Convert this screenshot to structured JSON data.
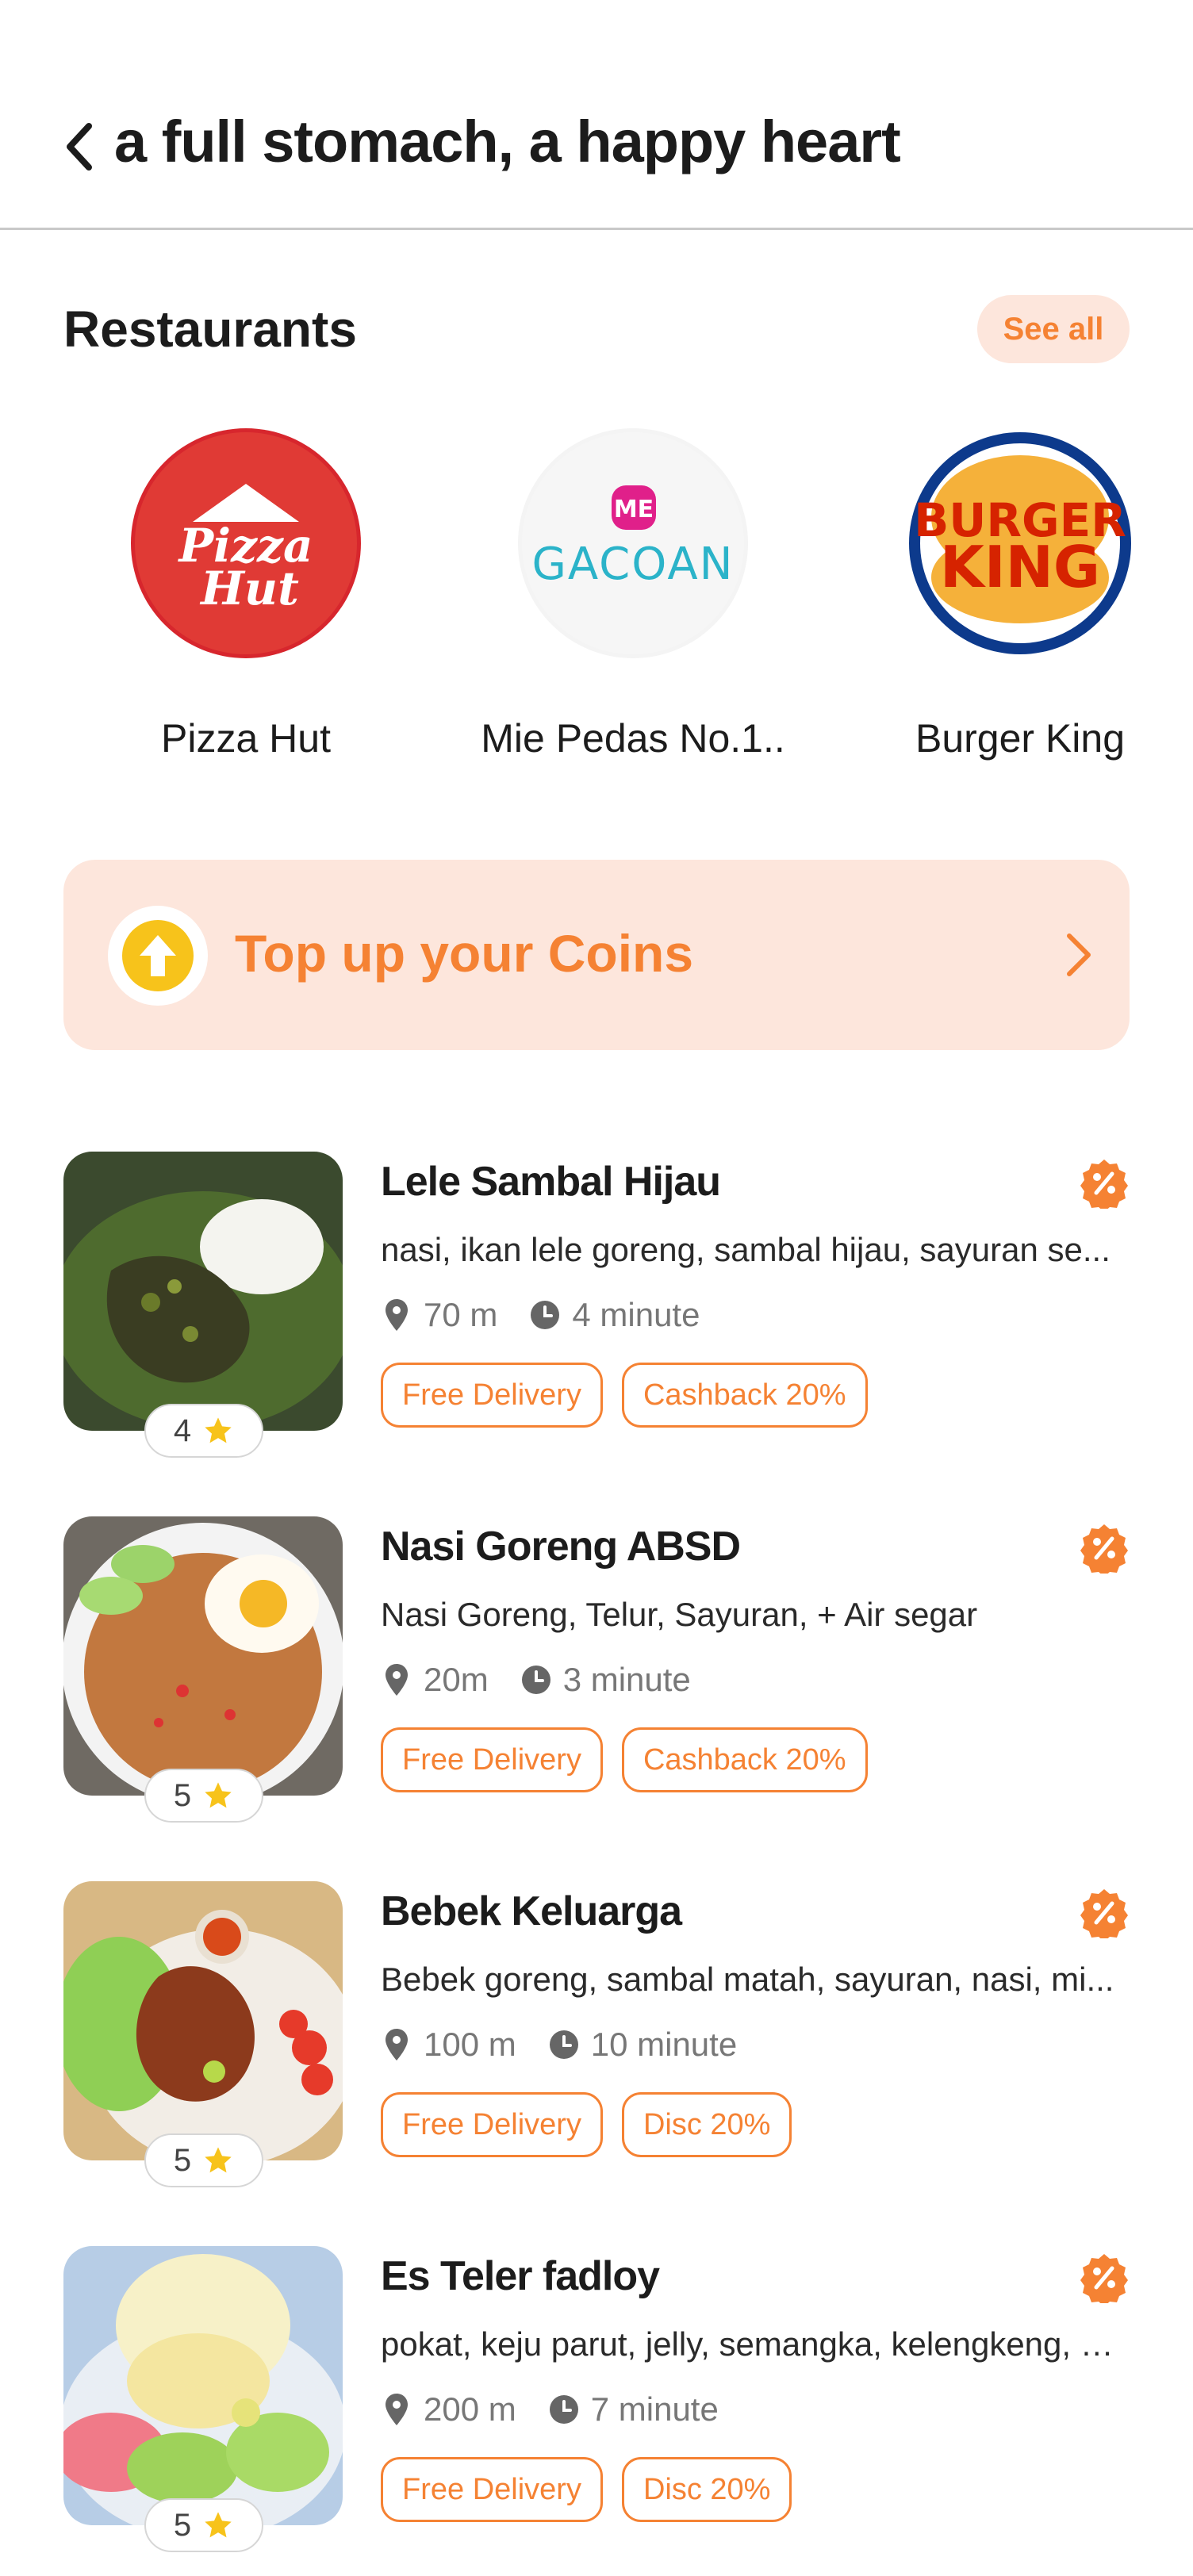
{
  "header": {
    "title": "a full stomach, a happy heart",
    "back_icon": "chevron-left-icon"
  },
  "restaurants_section": {
    "title": "Restaurants",
    "see_all": "See all",
    "items": [
      {
        "name": "Pizza Hut",
        "logo": "pizza-hut-logo"
      },
      {
        "name": "Mie Pedas No.1..",
        "logo": "mie-gacoan-logo"
      },
      {
        "name": "Burger King",
        "logo": "burger-king-logo"
      }
    ]
  },
  "topup": {
    "label": "Top up your Coins",
    "icon": "arrow-up-coin-icon",
    "chevron": "chevron-right-icon"
  },
  "foods": [
    {
      "title": "Lele Sambal Hijau",
      "desc": "nasi, ikan lele goreng, sambal hijau, sayuran se...",
      "distance": "70 m",
      "time": "4 minute",
      "rating": "4",
      "tags": [
        "Free Delivery",
        "Cashback 20%"
      ]
    },
    {
      "title": "Nasi Goreng ABSD",
      "desc": "Nasi Goreng, Telur, Sayuran, + Air segar",
      "distance": "20m",
      "time": "3 minute",
      "rating": "5",
      "tags": [
        "Free Delivery",
        "Cashback 20%"
      ]
    },
    {
      "title": "Bebek Keluarga",
      "desc": "Bebek goreng, sambal matah, sayuran, nasi, mi...",
      "distance": "100 m",
      "time": "10 minute",
      "rating": "5",
      "tags": [
        "Free Delivery",
        "Disc 20%"
      ]
    },
    {
      "title": "Es Teler fadloy",
      "desc": "pokat, keju parut, jelly, semangka, kelengkeng, s....",
      "distance": "200 m",
      "time": "7 minute",
      "rating": "5",
      "tags": [
        "Free Delivery",
        "Disc 20%"
      ]
    }
  ],
  "colors": {
    "accent": "#f58233",
    "accent_bg": "#fde6dc",
    "star": "#f7c31b",
    "text": "#1c1c1c"
  }
}
